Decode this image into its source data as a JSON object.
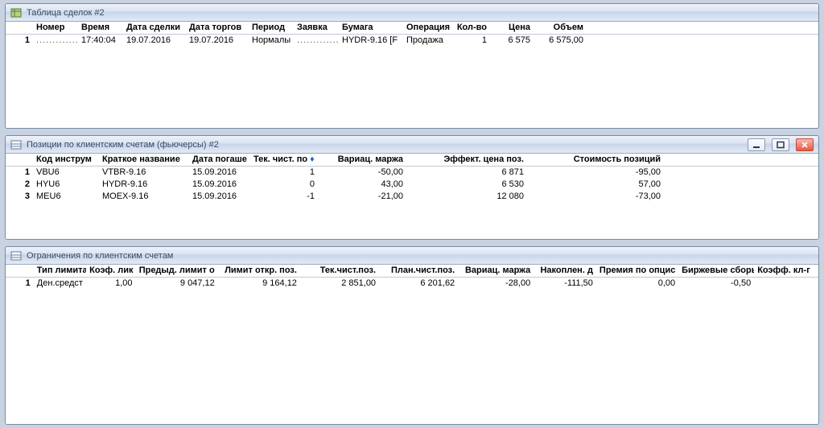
{
  "deals": {
    "title": "Таблица сделок #2",
    "columns": [
      "Номер",
      "Время",
      "Дата сделки",
      "Дата торгов",
      "Период",
      "Заявка",
      "Бумага",
      "Операция",
      "Кол-во",
      "Цена",
      "Объем"
    ],
    "rows": [
      {
        "n": "1",
        "num": "..................",
        "time": "17:40:04",
        "deal_date": "19.07.2016",
        "trade_date": "19.07.2016",
        "period": "Нормалы",
        "order": "................",
        "paper": "HYDR-9.16 [F",
        "op": "Продажа",
        "qty": "1",
        "price": "6 575",
        "vol": "6 575,00"
      }
    ]
  },
  "positions": {
    "title": "Позиции по клиентским счетам (фьючерсы) #2",
    "columns": [
      "Код инструм",
      "Краткое название",
      "Дата погаше",
      "Тек. чист. по",
      "Вариац. маржа",
      "Эффект. цена поз.",
      "Стоимость позиций"
    ],
    "sorted_col_label": "♦",
    "rows": [
      {
        "n": "1",
        "code": "VBU6",
        "name": "VTBR-9.16",
        "exp": "15.09.2016",
        "net": "1",
        "varm": "-50,00",
        "eff": "6 871",
        "cost": "-95,00"
      },
      {
        "n": "2",
        "code": "HYU6",
        "name": "HYDR-9.16",
        "exp": "15.09.2016",
        "net": "0",
        "varm": "43,00",
        "eff": "6 530",
        "cost": "57,00"
      },
      {
        "n": "3",
        "code": "MEU6",
        "name": "MOEX-9.16",
        "exp": "15.09.2016",
        "net": "-1",
        "varm": "-21,00",
        "eff": "12 080",
        "cost": "-73,00"
      }
    ]
  },
  "limits": {
    "title": "Ограничения по клиентским счетам",
    "columns": [
      "Тип лимита",
      "Коэф. лик",
      "Предыд. лимит о",
      "Лимит откр. поз.",
      "Тек.чист.поз.",
      "План.чист.поз.",
      "Вариац. маржа",
      "Накоплен. д",
      "Премия по опцис",
      "Биржевые сборы",
      "Коэфф. кл-г"
    ],
    "rows": [
      {
        "n": "1",
        "type": "Ден.средст",
        "liq": "1,00",
        "prev": "9 047,12",
        "open": "9 164,12",
        "cur": "2 851,00",
        "plan": "6 201,62",
        "varm": "-28,00",
        "acc": "-111,50",
        "prem": "0,00",
        "fees": "-0,50",
        "coef": ""
      }
    ]
  }
}
